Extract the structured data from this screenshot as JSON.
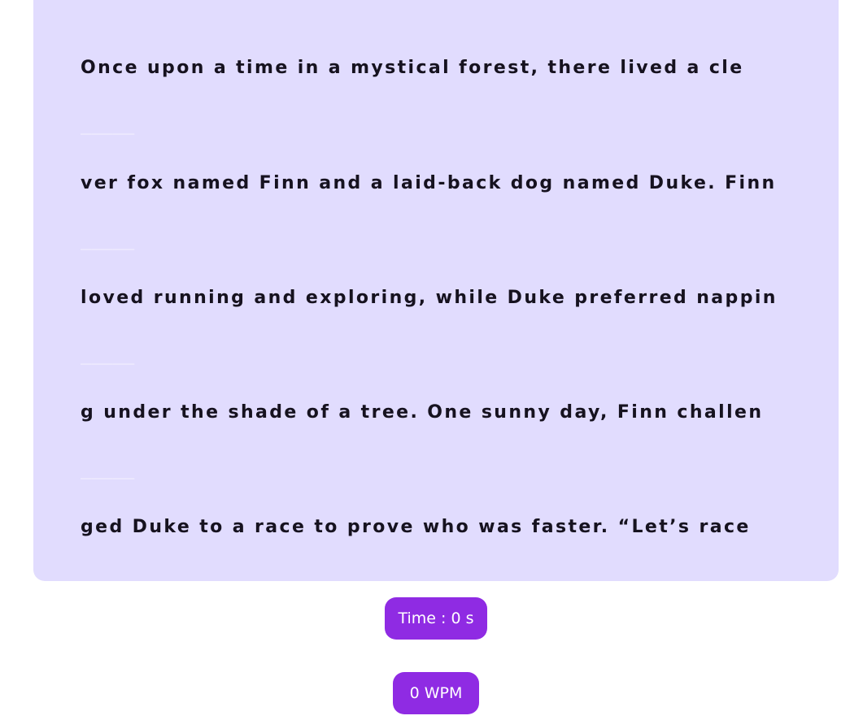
{
  "text_lines": [
    "Once upon a time in a mystical forest, there lived a cle",
    "ver fox named Finn and a laid-back dog named Duke. Finn",
    "loved running and exploring, while Duke preferred nappin",
    "g under the shade of a tree. One sunny day, Finn challen",
    "ged Duke to a race to prove who was faster. “Let’s race"
  ],
  "blank_marker": "_____",
  "stats": {
    "time_label": "Time : 0 s",
    "wpm_label": "0 WPM"
  },
  "colors": {
    "panel_bg": "#e1dcfe",
    "text": "#16121f",
    "accent": "#8f2be3"
  }
}
